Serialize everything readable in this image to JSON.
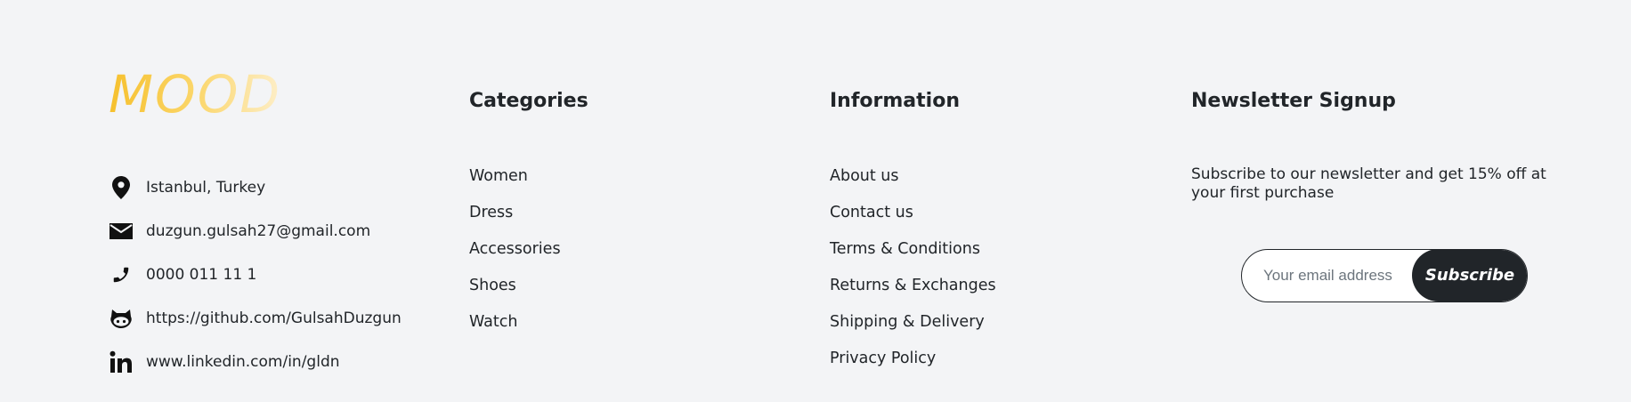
{
  "brand": {
    "logo": "MOOD",
    "contacts": [
      {
        "icon": "location-pin-icon",
        "text": "Istanbul, Turkey"
      },
      {
        "icon": "envelope-icon",
        "text": "duzgun.gulsah27@gmail.com"
      },
      {
        "icon": "phone-icon",
        "text": "0000 011 11 1"
      },
      {
        "icon": "github-icon",
        "text": "https://github.com/GulsahDuzgun"
      },
      {
        "icon": "linkedin-icon",
        "text": "www.linkedin.com/in/gldn"
      }
    ]
  },
  "categories": {
    "title": "Categories",
    "items": [
      "Women",
      "Dress",
      "Accessories",
      "Shoes",
      "Watch"
    ]
  },
  "information": {
    "title": "Information",
    "items": [
      "About us",
      "Contact us",
      "Terms & Conditions",
      "Returns & Exchanges",
      "Shipping & Delivery",
      "Privacy Policy"
    ]
  },
  "newsletter": {
    "title": "Newsletter Signup",
    "description": "Subscribe to our newsletter and get 15% off at your first purchase",
    "email_placeholder": "Your email address",
    "email_value": "",
    "button_label": "Subscribe"
  },
  "colors": {
    "background": "#f3f4f6",
    "text": "#212529",
    "logo_gradient_start": "#f6c02d",
    "logo_gradient_end": "#fdeec8",
    "button_bg": "#212529"
  }
}
